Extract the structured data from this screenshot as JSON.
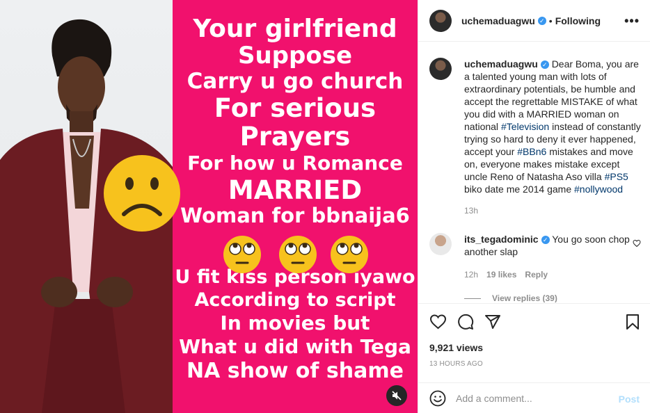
{
  "media": {
    "overlay_lines": [
      "Your girlfriend",
      "Suppose",
      "Carry u go church",
      "For serious",
      "Prayers",
      "For how u Romance",
      "MARRIED",
      "Woman for bbnaija6",
      "U fit kiss person iyawo",
      "According to script",
      "In movies but",
      "What u did with Tega",
      "NA show of shame"
    ],
    "colors": {
      "pink": "#f1116d",
      "suit": "#6b1c22"
    }
  },
  "header": {
    "username": "uchemaduagwu",
    "separator": "•",
    "follow_state": "Following",
    "more": "•••"
  },
  "caption": {
    "username": "uchemaduagwu",
    "text_1": "Dear Boma, you are a talented young man with lots of extraordinary potentials, be humble and accept the regrettable MISTAKE of what you did with a MARRIED woman on national ",
    "tag_1": "#Television",
    "text_2": " instead of constantly trying so hard to deny it ever happened, accept your ",
    "tag_2": "#BBn6",
    "text_3": " mistakes and move on, everyone makes mistake except uncle Reno of Natasha Aso villa ",
    "tag_3": "#PS5",
    "text_4": " biko date me 2014 game ",
    "tag_4": "#nollywood",
    "time": "13h"
  },
  "comment": {
    "username": "its_tegadominic",
    "text": "You go soon chop another slap",
    "time": "12h",
    "likes": "19 likes",
    "reply": "Reply",
    "view_replies": "View replies (39)"
  },
  "stats": {
    "views": "9,921 views",
    "ago": "13 HOURS AGO"
  },
  "add_comment": {
    "placeholder": "Add a comment...",
    "post": "Post"
  }
}
